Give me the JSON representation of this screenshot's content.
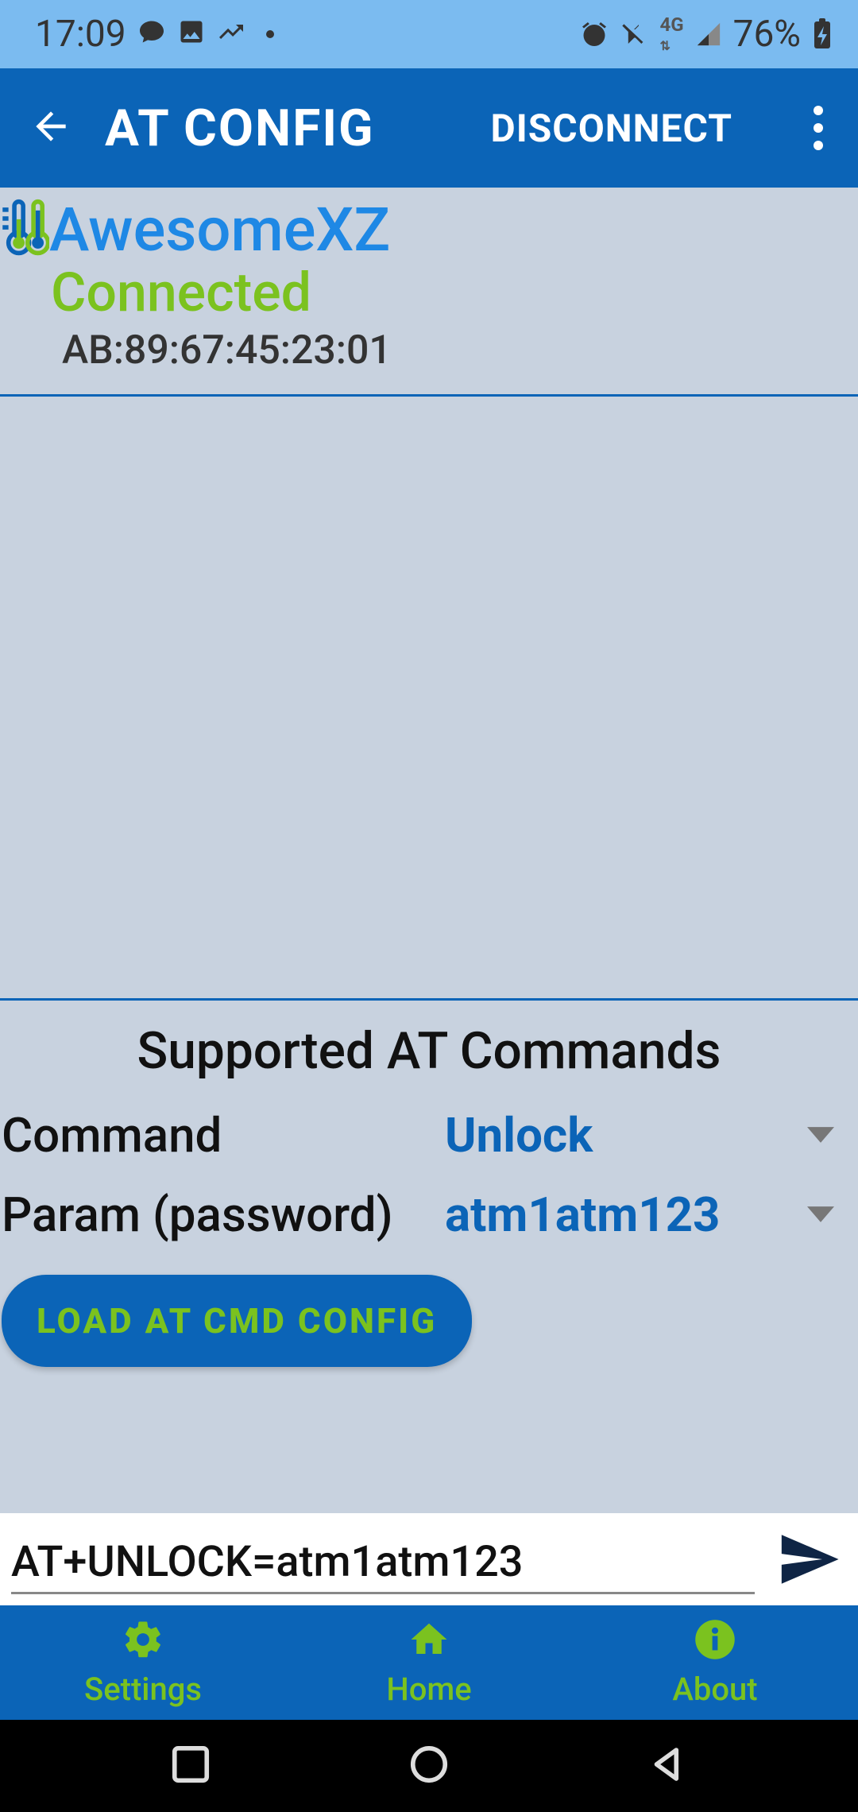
{
  "statusbar": {
    "time": "17:09",
    "battery": "76%"
  },
  "appbar": {
    "title": "AT CONFIG",
    "disconnect": "DISCONNECT"
  },
  "device": {
    "name": "AwesomeXZ",
    "status": "Connected",
    "mac": "AB:89:67:45:23:01"
  },
  "at": {
    "section_title": "Supported AT Commands",
    "command_label": "Command",
    "command_value": "Unlock",
    "param_label": "Param (password)",
    "param_value": "atm1atm123",
    "load_btn": "LOAD AT CMD CONFIG"
  },
  "cmdbar": {
    "value": "AT+UNLOCK=atm1atm123"
  },
  "nav": {
    "settings": "Settings",
    "home": "Home",
    "about": "About"
  }
}
